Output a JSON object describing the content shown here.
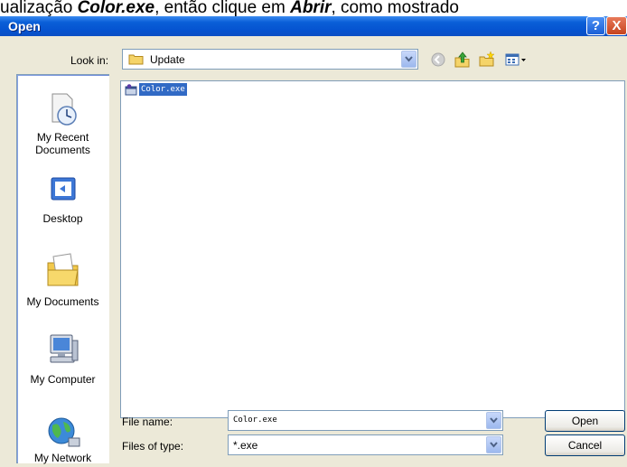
{
  "caption": {
    "pre": "ualização ",
    "file": "Color.exe",
    "mid": ", então clique em ",
    "action": "Abrir",
    "post": ", como mostrado"
  },
  "dialog": {
    "title": "Open",
    "help_glyph": "?",
    "close_glyph": "X"
  },
  "lookin": {
    "label": "Look in:",
    "value": "Update"
  },
  "toolbar": {
    "icons": [
      "back-icon",
      "up-folder-icon",
      "new-folder-icon",
      "view-menu-icon"
    ]
  },
  "places": [
    {
      "label": "My Recent Documents",
      "icon": "recent-documents-icon"
    },
    {
      "label": "Desktop",
      "icon": "desktop-icon"
    },
    {
      "label": "My Documents",
      "icon": "my-documents-icon"
    },
    {
      "label": "My Computer",
      "icon": "my-computer-icon"
    },
    {
      "label": "My Network",
      "icon": "network-icon"
    }
  ],
  "files": [
    {
      "name": "Color.exe",
      "selected": true
    }
  ],
  "filename": {
    "label": "File name:",
    "value": "Color.exe"
  },
  "filetype": {
    "label": "Files of type:",
    "value": "*.exe"
  },
  "buttons": {
    "open": "Open",
    "cancel": "Cancel"
  },
  "colors": {
    "titlebar": "#0553d0",
    "dialog_bg": "#ece9d8",
    "selection": "#316ac5",
    "places_bar": "#7a96df"
  }
}
